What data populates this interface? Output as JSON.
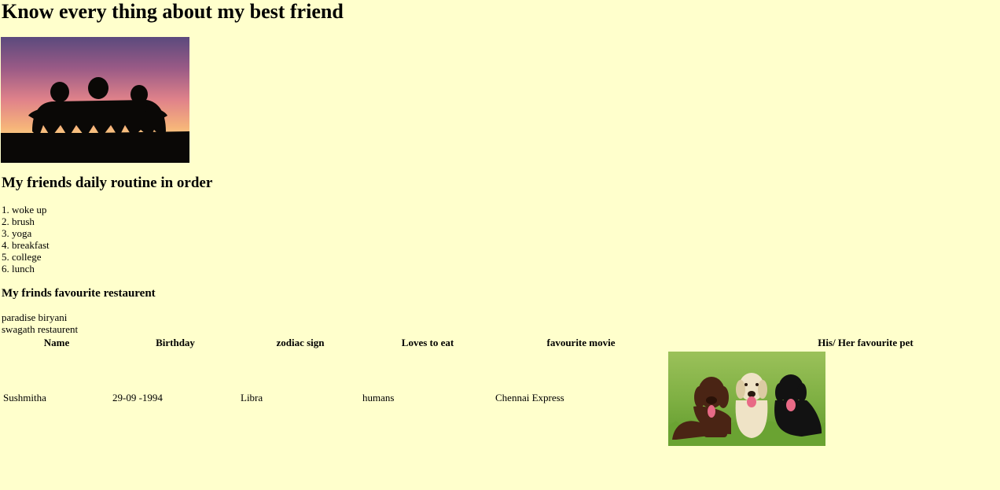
{
  "page": {
    "title": "Know every thing about my best friend",
    "hero_image": "friends-silhouette-sunset-image",
    "routine_heading": "My friends daily routine in order",
    "routine": [
      "1. woke up",
      "2. brush",
      "3. yoga",
      "4. breakfast",
      "5. college",
      "6. lunch"
    ],
    "restaurant_heading": "My frinds favourite restaurent",
    "restaurants": [
      "paradise biryani",
      "swagath restaurent"
    ]
  },
  "table": {
    "headers": [
      "Name",
      "Birthday",
      "zodiac sign",
      "Loves to eat",
      "favourite movie",
      "His/ Her favourite pet"
    ],
    "row": [
      "Sushmitha",
      "29-09 -1994",
      "Libra",
      "humans",
      "Chennai Express"
    ],
    "pet_image": "three-labrador-dogs-image"
  },
  "colors": {
    "background": "#ffffcc",
    "text": "#000000"
  }
}
